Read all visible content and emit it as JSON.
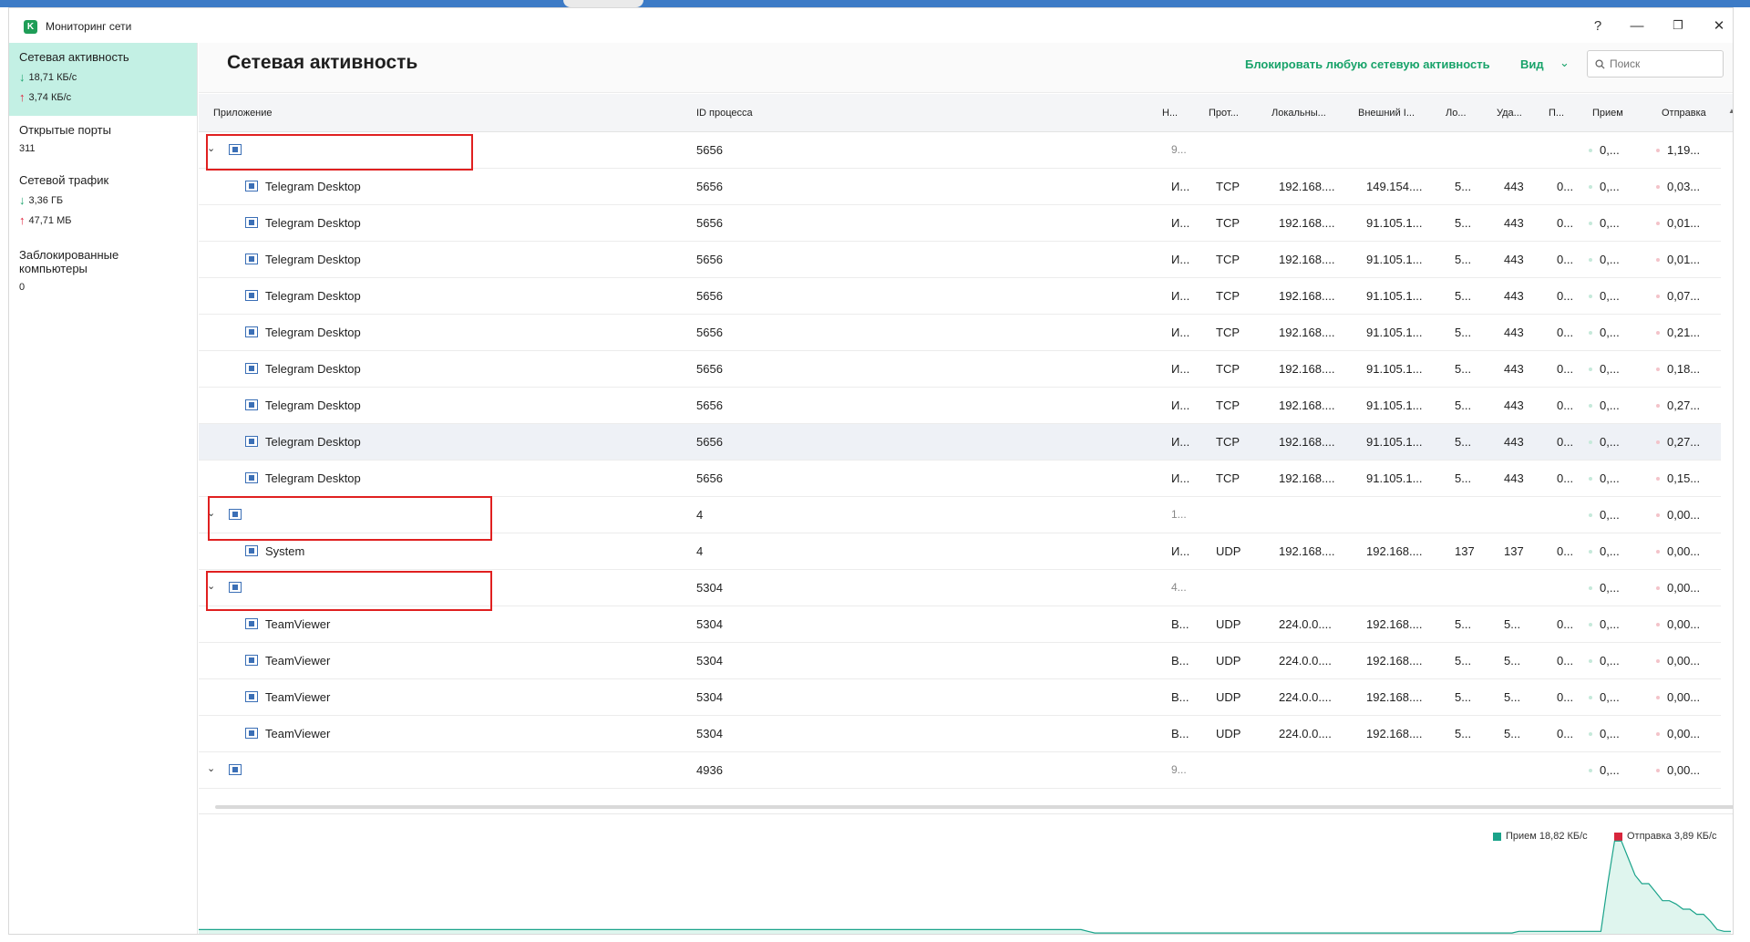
{
  "window": {
    "title": "Мониторинг сети",
    "logo_letter": "K",
    "help": "?",
    "minimize": "—",
    "restore": "❐",
    "close": "✕"
  },
  "sidebar": {
    "items": [
      {
        "label": "Сетевая активность",
        "down": "18,71 КБ/с",
        "up": "3,74 КБ/с"
      },
      {
        "label": "Открытые порты",
        "value": "311"
      },
      {
        "label": "Сетевой трафик",
        "down": "3,36 ГБ",
        "up": "47,71 МБ"
      },
      {
        "label_line1": "Заблокированные",
        "label_line2": "компьютеры",
        "value": "0"
      }
    ]
  },
  "header": {
    "title": "Сетевая активность",
    "block_link": "Блокировать любую сетевую активность",
    "view_label": "Вид",
    "search_placeholder": "Поиск"
  },
  "columns": [
    "Приложение",
    "ID процесса",
    "Н...",
    "Прот...",
    "Локальны...",
    "Внешний I...",
    "Ло...",
    "Уда...",
    "П...",
    "Прием",
    "Отправка"
  ],
  "rows": [
    {
      "group": true,
      "app": "",
      "pid": "5656",
      "n": "9...",
      "recv": "0,...",
      "send": "1,19..."
    },
    {
      "app": "Telegram Desktop",
      "pid": "5656",
      "n": "И...",
      "proto": "TCP",
      "local": "192.168....",
      "remote": "149.154....",
      "lport": "5...",
      "rport": "443",
      "p": "0...",
      "recv": "0,...",
      "send": "0,03..."
    },
    {
      "app": "Telegram Desktop",
      "pid": "5656",
      "n": "И...",
      "proto": "TCP",
      "local": "192.168....",
      "remote": "91.105.1...",
      "lport": "5...",
      "rport": "443",
      "p": "0...",
      "recv": "0,...",
      "send": "0,01..."
    },
    {
      "app": "Telegram Desktop",
      "pid": "5656",
      "n": "И...",
      "proto": "TCP",
      "local": "192.168....",
      "remote": "91.105.1...",
      "lport": "5...",
      "rport": "443",
      "p": "0...",
      "recv": "0,...",
      "send": "0,01..."
    },
    {
      "app": "Telegram Desktop",
      "pid": "5656",
      "n": "И...",
      "proto": "TCP",
      "local": "192.168....",
      "remote": "91.105.1...",
      "lport": "5...",
      "rport": "443",
      "p": "0...",
      "recv": "0,...",
      "send": "0,07..."
    },
    {
      "app": "Telegram Desktop",
      "pid": "5656",
      "n": "И...",
      "proto": "TCP",
      "local": "192.168....",
      "remote": "91.105.1...",
      "lport": "5...",
      "rport": "443",
      "p": "0...",
      "recv": "0,...",
      "send": "0,21..."
    },
    {
      "app": "Telegram Desktop",
      "pid": "5656",
      "n": "И...",
      "proto": "TCP",
      "local": "192.168....",
      "remote": "91.105.1...",
      "lport": "5...",
      "rport": "443",
      "p": "0...",
      "recv": "0,...",
      "send": "0,18..."
    },
    {
      "app": "Telegram Desktop",
      "pid": "5656",
      "n": "И...",
      "proto": "TCP",
      "local": "192.168....",
      "remote": "91.105.1...",
      "lport": "5...",
      "rport": "443",
      "p": "0...",
      "recv": "0,...",
      "send": "0,27..."
    },
    {
      "app": "Telegram Desktop",
      "pid": "5656",
      "n": "И...",
      "proto": "TCP",
      "local": "192.168....",
      "remote": "91.105.1...",
      "lport": "5...",
      "rport": "443",
      "p": "0...",
      "recv": "0,...",
      "send": "0,27...",
      "highlight": true
    },
    {
      "app": "Telegram Desktop",
      "pid": "5656",
      "n": "И...",
      "proto": "TCP",
      "local": "192.168....",
      "remote": "91.105.1...",
      "lport": "5...",
      "rport": "443",
      "p": "0...",
      "recv": "0,...",
      "send": "0,15..."
    },
    {
      "group": true,
      "app": "",
      "pid": "4",
      "n": "1...",
      "recv": "0,...",
      "send": "0,00..."
    },
    {
      "app": "System",
      "pid": "4",
      "n": "И...",
      "proto": "UDP",
      "local": "192.168....",
      "remote": "192.168....",
      "lport": "137",
      "rport": "137",
      "p": "0...",
      "recv": "0,...",
      "send": "0,00..."
    },
    {
      "group": true,
      "app": "",
      "pid": "5304",
      "n": "4...",
      "recv": "0,...",
      "send": "0,00..."
    },
    {
      "app": "TeamViewer",
      "pid": "5304",
      "n": "В...",
      "proto": "UDP",
      "local": "224.0.0....",
      "remote": "192.168....",
      "lport": "5...",
      "rport": "5...",
      "p": "0...",
      "recv": "0,...",
      "send": "0,00..."
    },
    {
      "app": "TeamViewer",
      "pid": "5304",
      "n": "В...",
      "proto": "UDP",
      "local": "224.0.0....",
      "remote": "192.168....",
      "lport": "5...",
      "rport": "5...",
      "p": "0...",
      "recv": "0,...",
      "send": "0,00..."
    },
    {
      "app": "TeamViewer",
      "pid": "5304",
      "n": "В...",
      "proto": "UDP",
      "local": "224.0.0....",
      "remote": "192.168....",
      "lport": "5...",
      "rport": "5...",
      "p": "0...",
      "recv": "0,...",
      "send": "0,00..."
    },
    {
      "app": "TeamViewer",
      "pid": "5304",
      "n": "В...",
      "proto": "UDP",
      "local": "224.0.0....",
      "remote": "192.168....",
      "lport": "5...",
      "rport": "5...",
      "p": "0...",
      "recv": "0,...",
      "send": "0,00..."
    },
    {
      "group": true,
      "app": "",
      "pid": "4936",
      "n": "9...",
      "recv": "0,...",
      "send": "0,00..."
    }
  ],
  "traffic_chart": {
    "legend_recv": "Прием 18,82 КБ/с",
    "legend_send": "Отправка 3,89 КБ/с",
    "recv_color": "#1aa38a",
    "send_color": "#d8253c",
    "recv_values": [
      3,
      3,
      3,
      3,
      3,
      3,
      3,
      3,
      3,
      3,
      3,
      3,
      3,
      3,
      3,
      3,
      3,
      3,
      3,
      3,
      3,
      3,
      3,
      3,
      3,
      3,
      3,
      3,
      3,
      3,
      3,
      3,
      3,
      3,
      3,
      3,
      3,
      3,
      3,
      3,
      3,
      3,
      3,
      3,
      3,
      3,
      3,
      3,
      3,
      3,
      3,
      3,
      3,
      3,
      3,
      3,
      3,
      3,
      3,
      3,
      3,
      3,
      3,
      3,
      3,
      3,
      3,
      3,
      3,
      3,
      3,
      3,
      3,
      3,
      3,
      3,
      3,
      3,
      3,
      3,
      3,
      3,
      3,
      3,
      3,
      3,
      3,
      3,
      3,
      3,
      3,
      3,
      3,
      3,
      3,
      3,
      3,
      3,
      3,
      3,
      3,
      3,
      3,
      3,
      3,
      3,
      3,
      3,
      3,
      3,
      3,
      3,
      3,
      3,
      3,
      3,
      3,
      3,
      3,
      3,
      3,
      3,
      3,
      3,
      3,
      3,
      3,
      3,
      3,
      3,
      2,
      1,
      1,
      1,
      1,
      1,
      1,
      1,
      1,
      1,
      1,
      1,
      1,
      1,
      1,
      1,
      1,
      1,
      1,
      1,
      1,
      1,
      1,
      1,
      1,
      1,
      1,
      1,
      1,
      1,
      1,
      1,
      1,
      1,
      1,
      1,
      1,
      1,
      1,
      1,
      1,
      1,
      1,
      1,
      1,
      1,
      1,
      1,
      1,
      1,
      1,
      1,
      1,
      1,
      1,
      1,
      1,
      1,
      1,
      1,
      1,
      1,
      1,
      2,
      2,
      2,
      2,
      2,
      2,
      2,
      2,
      2,
      2,
      2,
      2,
      2,
      30,
      55,
      55,
      45,
      35,
      30,
      30,
      25,
      20,
      20,
      18,
      15,
      15,
      12,
      12,
      8,
      3,
      2,
      2
    ]
  }
}
